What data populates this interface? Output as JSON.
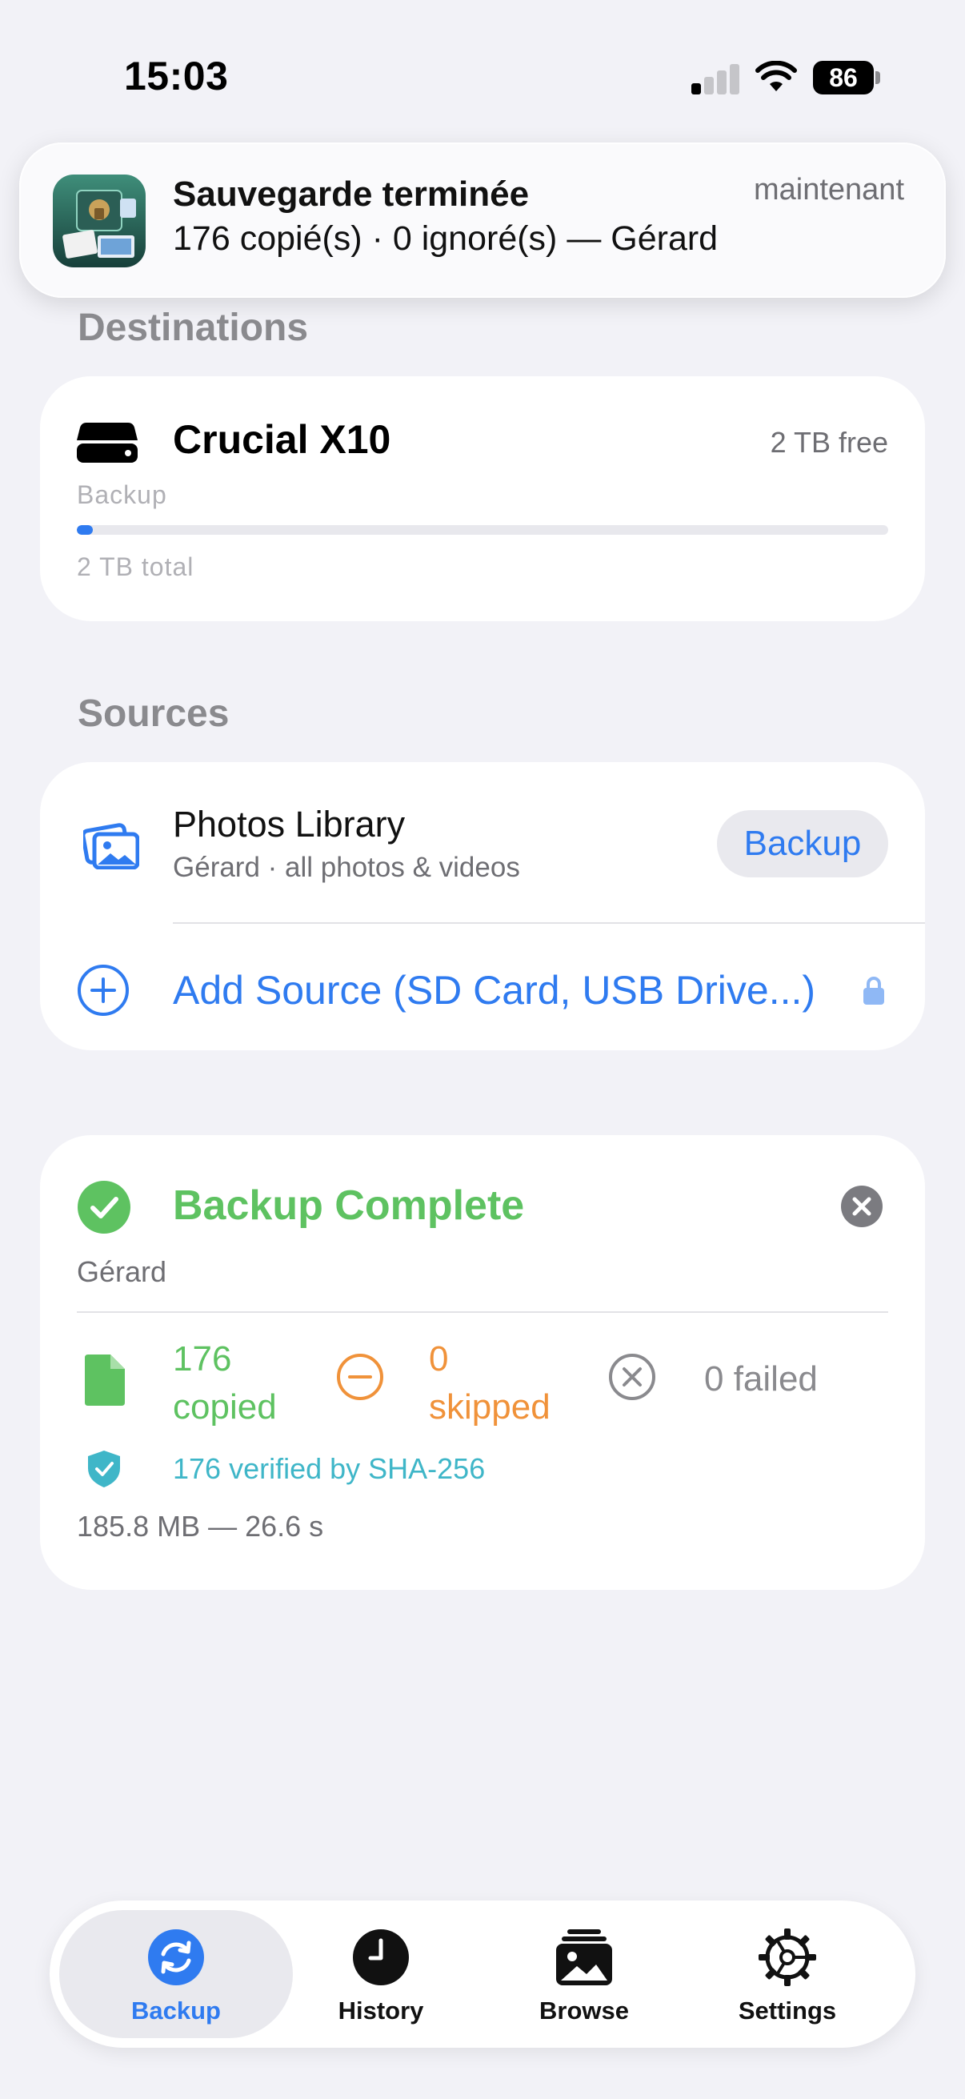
{
  "status_bar": {
    "time": "15:03",
    "battery": "86"
  },
  "notification": {
    "title": "Sauvegarde terminée",
    "time": "maintenant",
    "body": "176 copié(s) · 0 ignoré(s) — Gérard"
  },
  "destinations": {
    "header": "Destinations",
    "drive": {
      "name": "Crucial X10",
      "free": "2 TB free",
      "subtitle": "Backup",
      "used_fraction": 0.02,
      "total": "2 TB total"
    }
  },
  "sources": {
    "header": "Sources",
    "library": {
      "name": "Photos Library",
      "subtitle": "Gérard  · all photos & videos",
      "action": "Backup"
    },
    "add_label": "Add Source (SD Card, USB Drive...)"
  },
  "result": {
    "title": "Backup Complete",
    "user": "Gérard",
    "copied": {
      "count": "176",
      "label": "copied"
    },
    "skipped": {
      "count": "0",
      "label": "skipped"
    },
    "failed": "0 failed",
    "verified": "176 verified by SHA-256",
    "size_time": "185.8 MB — 26.6 s"
  },
  "tabs": [
    {
      "label": "Backup",
      "icon": "backup-icon",
      "active": true
    },
    {
      "label": "History",
      "icon": "clock-icon",
      "active": false
    },
    {
      "label": "Browse",
      "icon": "photos-stack-icon",
      "active": false
    },
    {
      "label": "Settings",
      "icon": "gear-icon",
      "active": false
    }
  ],
  "colors": {
    "accent": "#2f7bf0",
    "success": "#5ec261",
    "warning": "#f0923a",
    "verified": "#3fb6c8",
    "background": "#f2f2f7"
  }
}
